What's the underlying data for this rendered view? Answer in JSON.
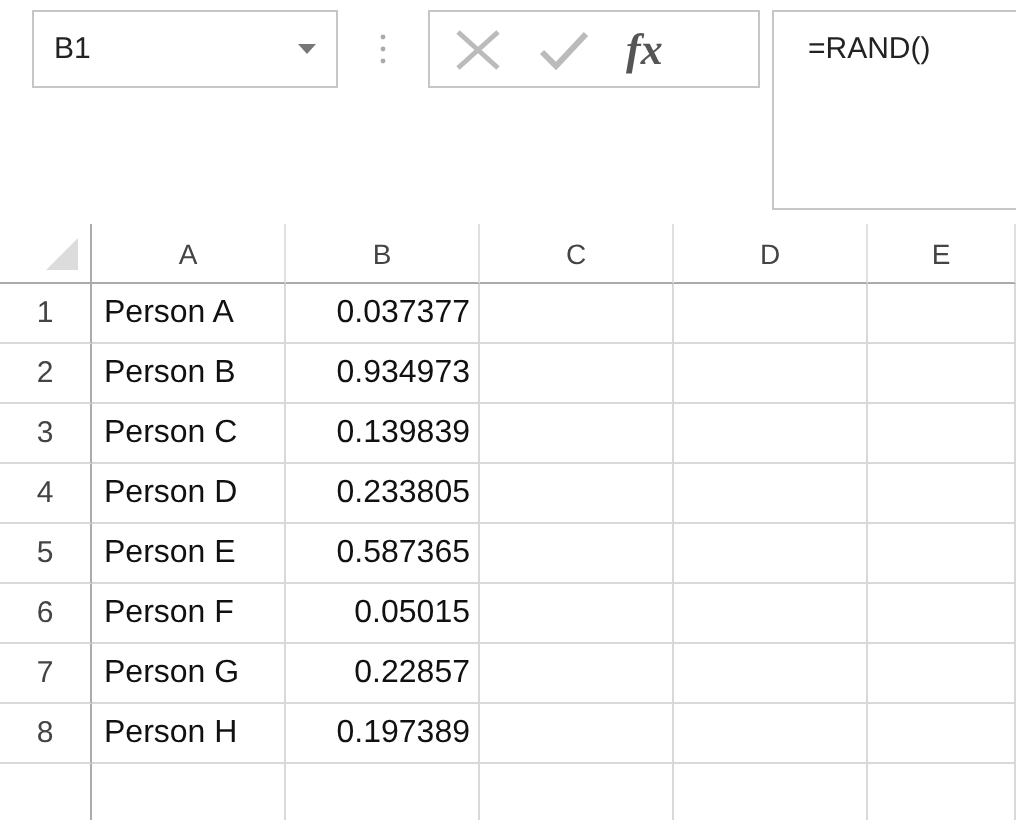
{
  "name_box": {
    "value": "B1"
  },
  "formula_bar": {
    "insert_function": "fx",
    "formula": "=RAND()"
  },
  "columns": [
    "A",
    "B",
    "C",
    "D",
    "E"
  ],
  "rows": [
    {
      "number": "1",
      "name": "Person A",
      "value": "0.037377"
    },
    {
      "number": "2",
      "name": "Person B",
      "value": "0.934973"
    },
    {
      "number": "3",
      "name": "Person C",
      "value": "0.139839"
    },
    {
      "number": "4",
      "name": "Person D",
      "value": "0.233805"
    },
    {
      "number": "5",
      "name": "Person E",
      "value": "0.587365"
    },
    {
      "number": "6",
      "name": "Person F",
      "value": "0.05015"
    },
    {
      "number": "7",
      "name": "Person G",
      "value": "0.22857"
    },
    {
      "number": "8",
      "name": "Person H",
      "value": "0.197389"
    }
  ]
}
